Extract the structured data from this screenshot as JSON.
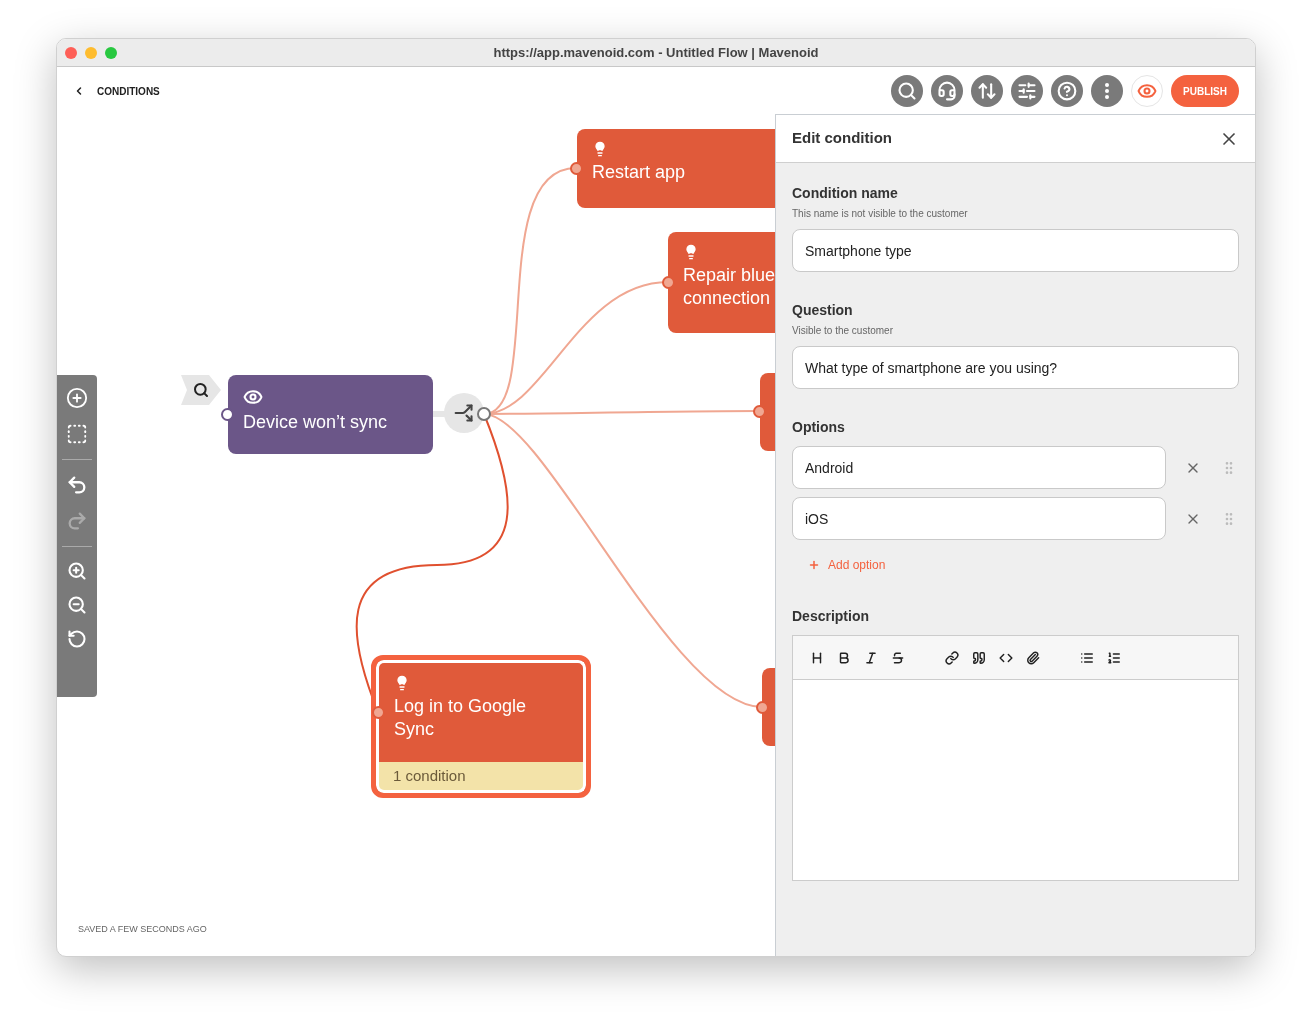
{
  "window": {
    "title": "https://app.mavenoid.com - Untitled Flow | Mavenoid"
  },
  "header": {
    "back_label": "CONDITIONS",
    "publish_label": "PUBLISH"
  },
  "canvas": {
    "nodes": [
      {
        "kind": "question",
        "title_lines": [
          "Device won’t sync"
        ],
        "selected": false
      },
      {
        "kind": "solution",
        "title_lines": [
          "Restart app"
        ],
        "selected": false
      },
      {
        "kind": "solution",
        "title_lines": [
          "Repair blue",
          "connection"
        ],
        "selected": false
      },
      {
        "kind": "solution",
        "selected": false
      },
      {
        "kind": "solution",
        "selected": false
      },
      {
        "kind": "solution",
        "title_lines": [
          "Log in to Google",
          "Sync"
        ],
        "selected": true,
        "badge": "1 condition"
      }
    ],
    "status": "SAVED A FEW SECONDS AGO"
  },
  "panel": {
    "title": "Edit condition",
    "name_field": {
      "label": "Condition name",
      "hint": "This name is not visible to the customer",
      "value": "Smartphone type"
    },
    "question_field": {
      "label": "Question",
      "hint": "Visible to the customer",
      "value": "What type of smartphone are you using?"
    },
    "options_label": "Options",
    "options": [
      {
        "value": "Android"
      },
      {
        "value": "iOS"
      }
    ],
    "add_option": "Add option",
    "description_label": "Description"
  }
}
